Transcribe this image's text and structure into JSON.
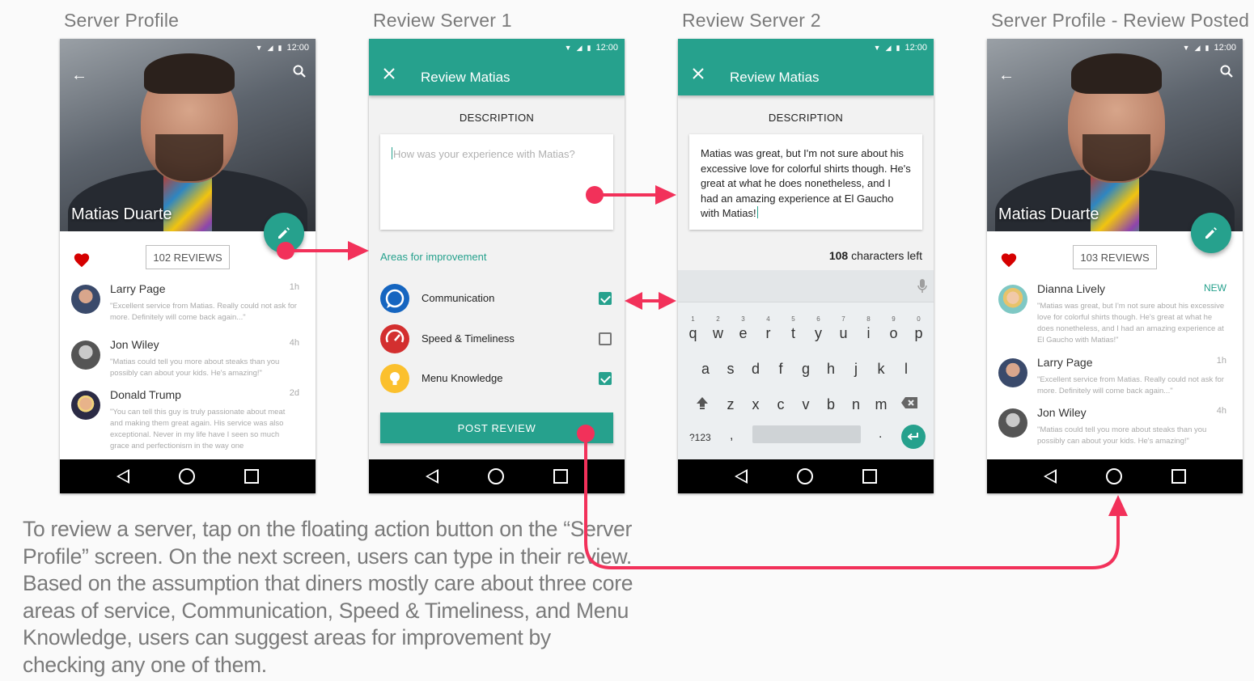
{
  "screens": {
    "s1": {
      "label": "Server Profile",
      "name": "Matias Duarte",
      "reviews_count": "102 REVIEWS",
      "time": "12:00",
      "reviews": [
        {
          "name": "Larry Page",
          "time": "1h",
          "text": "\"Excellent service from Matias. Really could not ask for more. Definitely will come back again...\""
        },
        {
          "name": "Jon Wiley",
          "time": "4h",
          "text": "\"Matias could tell you more about steaks than you possibly can about your kids. He's amazing!\""
        },
        {
          "name": "Donald Trump",
          "time": "2d",
          "text": "\"You can tell this guy is truly passionate about meat and making them great again. His service was also exceptional. Never in my life have I seen so much grace and perfectionism in the way one"
        }
      ]
    },
    "s2": {
      "label": "Review Server 1",
      "title": "Review Matias",
      "time": "12:00",
      "section": "DESCRIPTION",
      "placeholder": "How was your experience with Matias?",
      "areas_label": "Areas for improvement",
      "areas": [
        {
          "label": "Communication",
          "checked": true,
          "icon": "chat-bubble-icon",
          "color": "#1565c0"
        },
        {
          "label": "Speed & Timeliness",
          "checked": false,
          "icon": "speedometer-icon",
          "color": "#d32f2f"
        },
        {
          "label": "Menu Knowledge",
          "checked": true,
          "icon": "lightbulb-icon",
          "color": "#fbc02d"
        }
      ],
      "button": "POST REVIEW"
    },
    "s3": {
      "label": "Review Server 2",
      "title": "Review Matias",
      "time": "12:00",
      "section": "DESCRIPTION",
      "review": "Matias was great, but I'm not sure about his excessive love for colorful shirts though. He's great at what he does nonetheless, and I had an amazing experience at El Gaucho with Matias!",
      "chars_count": "108",
      "chars_label": "characters left",
      "keyboard": {
        "row1": [
          "q",
          "w",
          "e",
          "r",
          "t",
          "y",
          "u",
          "i",
          "o",
          "p"
        ],
        "row1_hints": [
          "1",
          "2",
          "3",
          "4",
          "5",
          "6",
          "7",
          "8",
          "9",
          "0"
        ],
        "row2": [
          "a",
          "s",
          "d",
          "f",
          "g",
          "h",
          "j",
          "k",
          "l"
        ],
        "row3": [
          "z",
          "x",
          "c",
          "v",
          "b",
          "n",
          "m"
        ],
        "symbols": "?123",
        "comma": ",",
        "period": "."
      }
    },
    "s4": {
      "label": "Server Profile - Review Posted",
      "name": "Matias Duarte",
      "reviews_count": "103 REVIEWS",
      "time": "12:00",
      "reviews": [
        {
          "name": "Dianna Lively",
          "time": "NEW",
          "text": "\"Matias was great, but I'm not sure about his excessive love for colorful shirts though. He's great at what he does nonetheless, and I had an amazing experience at El Gaucho with Matias!\""
        },
        {
          "name": "Larry Page",
          "time": "1h",
          "text": "\"Excellent service from Matias. Really could not ask for more. Definitely will come back again...\""
        },
        {
          "name": "Jon Wiley",
          "time": "4h",
          "text": "\"Matias could tell you more about steaks than you possibly can about your kids. He's amazing!\""
        }
      ]
    }
  },
  "caption": "To review a server, tap on the floating action button on the “Server Profile” screen. On the next screen, users can type in their review. Based on the assumption that diners mostly care about three core areas of service, Communication, Speed & Timeliness, and Menu Knowledge, users can suggest areas for improvement by checking any one of them.",
  "colors": {
    "primary": "#26a18d",
    "arrow": "#f2315a",
    "heart": "#d50000"
  }
}
